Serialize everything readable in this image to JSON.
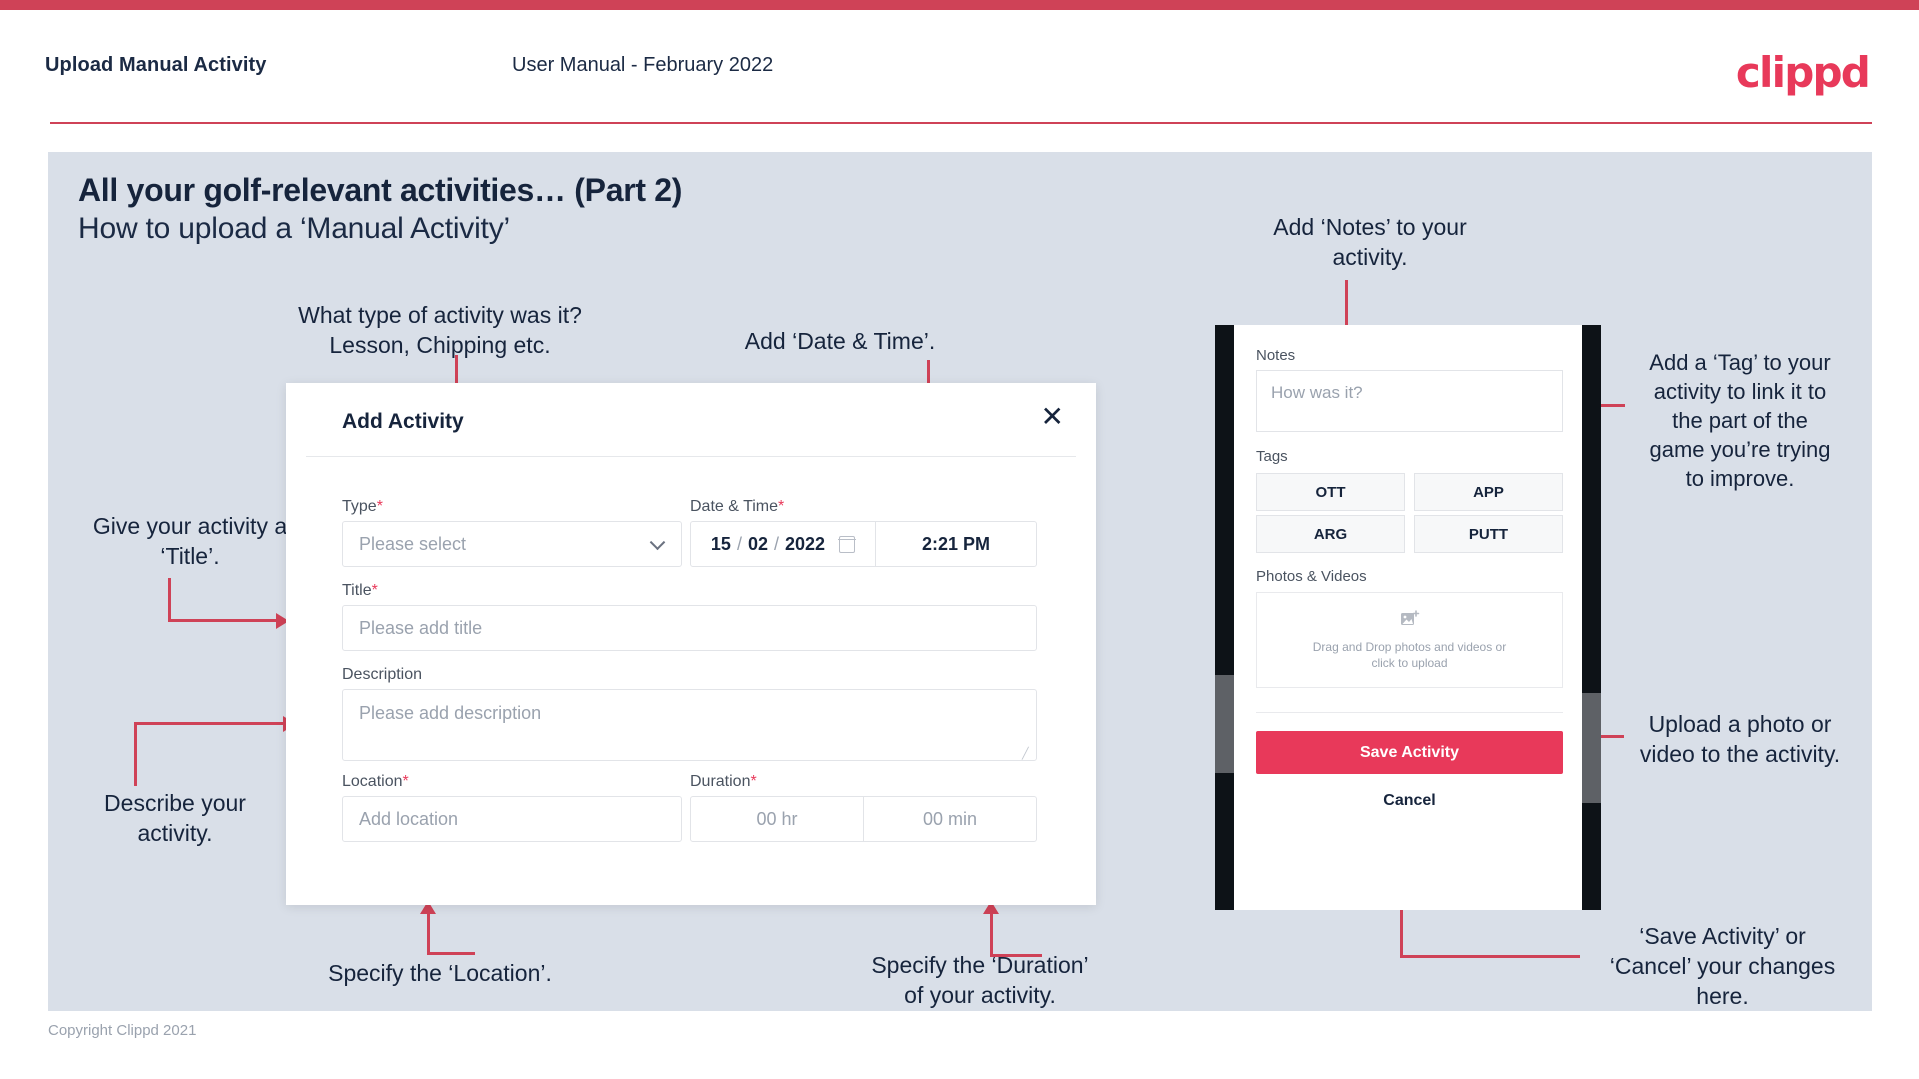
{
  "header": {
    "title": "Upload Manual Activity",
    "subtitle": "User Manual - February 2022",
    "logo": "clippd"
  },
  "slide": {
    "heading": "All your golf-relevant activities… (Part 2)",
    "subheading": "How to upload a ‘Manual Activity’",
    "copyright": "Copyright Clippd 2021"
  },
  "annotations": {
    "type": "What type of activity was it?\nLesson, Chipping etc.",
    "datetime": "Add ‘Date & Time’.",
    "notes": "Add ‘Notes’ to your\nactivity.",
    "tag": "Add a ‘Tag’ to your\nactivity to link it to\nthe part of the\ngame you’re trying\nto improve.",
    "title": "Give your activity a\n‘Title’.",
    "describe": "Describe your\nactivity.",
    "location": "Specify the ‘Location’.",
    "duration": "Specify the ‘Duration’\nof your activity.",
    "upload": "Upload a photo or\nvideo to the activity.",
    "save": "‘Save Activity’ or\n‘Cancel’ your changes\nhere."
  },
  "dialog": {
    "title": "Add Activity",
    "close_icon": "close-icon",
    "fields": {
      "type": {
        "label": "Type",
        "required": "*",
        "placeholder": "Please select",
        "value": ""
      },
      "datetime": {
        "label": "Date & Time",
        "required": "*",
        "day": "15",
        "month": "02",
        "year": "2022",
        "sep": "/",
        "time": "2:21 PM",
        "calendar_icon": "calendar-icon"
      },
      "title": {
        "label": "Title",
        "required": "*",
        "placeholder": "Please add title",
        "value": ""
      },
      "description": {
        "label": "Description",
        "required": "",
        "placeholder": "Please add description",
        "value": ""
      },
      "location": {
        "label": "Location",
        "required": "*",
        "placeholder": "Add location",
        "value": ""
      },
      "duration": {
        "label": "Duration",
        "required": "*",
        "hours_placeholder": "00 hr",
        "minutes_placeholder": "00 min"
      }
    }
  },
  "phone": {
    "notes": {
      "label": "Notes",
      "placeholder": "How was it?"
    },
    "tags": {
      "label": "Tags",
      "items": [
        "OTT",
        "APP",
        "ARG",
        "PUTT"
      ]
    },
    "photos": {
      "label": "Photos & Videos",
      "icon": "add-image-icon",
      "line1": "Drag and Drop photos and videos or",
      "line2": "click to upload"
    },
    "save_label": "Save Activity",
    "cancel_label": "Cancel"
  },
  "colors": {
    "accent": "#cf4257",
    "brand": "#e8395a",
    "slide_bg": "#d9dfe8",
    "ink": "#16243c"
  }
}
